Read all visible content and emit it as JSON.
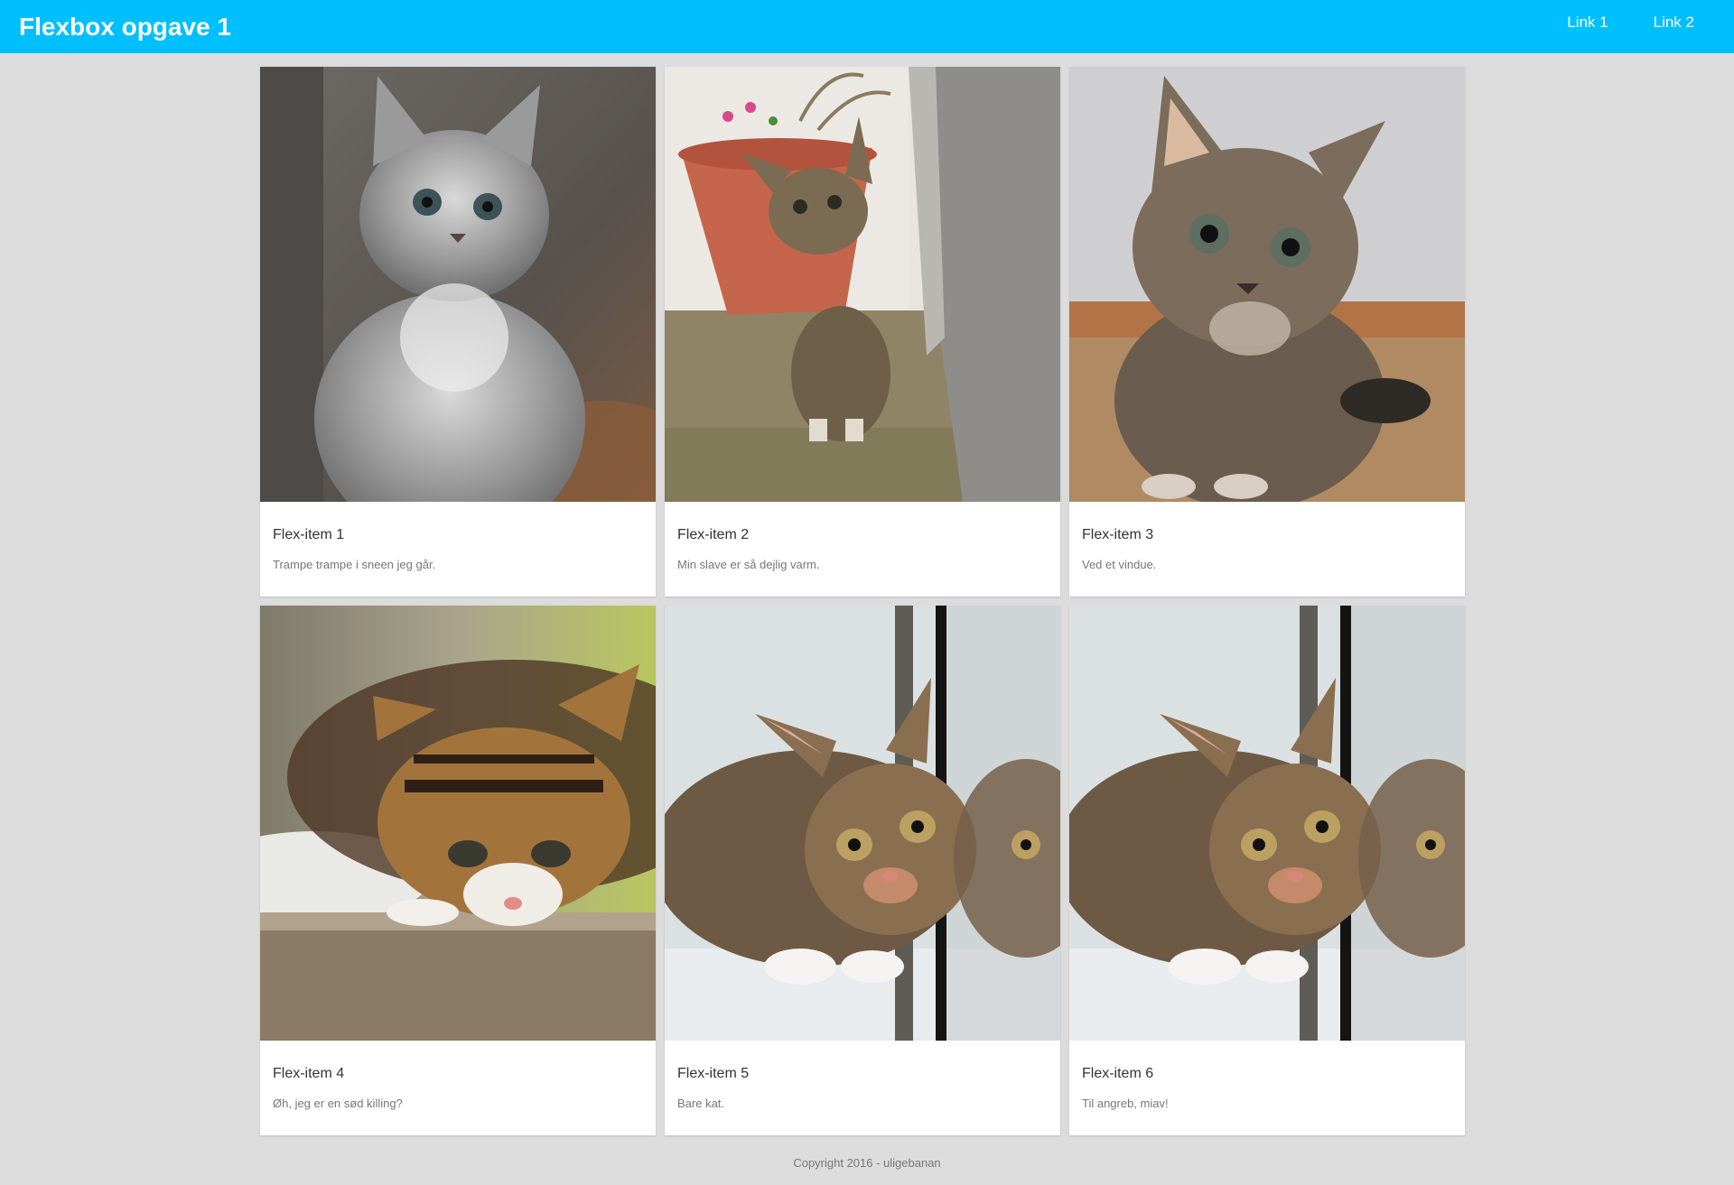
{
  "header": {
    "brand": "Flexbox opgave 1",
    "links": [
      "Link 1",
      "Link 2"
    ]
  },
  "colors": {
    "header_bg": "#00bfff",
    "page_bg": "#dcdcdc",
    "card_bg": "#ffffff"
  },
  "cards": [
    {
      "title": "Flex-item 1",
      "text": "Trampe trampe i sneen jeg går.",
      "image": "grey-kitten-photo"
    },
    {
      "title": "Flex-item 2",
      "text": "Min slave er så dejlig varm.",
      "image": "tabby-kitten-flowerpot-photo"
    },
    {
      "title": "Flex-item 3",
      "text": "Ved et vindue.",
      "image": "fluffy-tabby-kitten-photo"
    },
    {
      "title": "Flex-item 4",
      "text": "Øh, jeg er en sød killing?",
      "image": "calico-kitten-photo"
    },
    {
      "title": "Flex-item 5",
      "text": "Bare kat.",
      "image": "kitten-mirror-photo"
    },
    {
      "title": "Flex-item 6",
      "text": "Til angreb, miav!",
      "image": "kitten-mirror-photo"
    }
  ],
  "footer": {
    "text": "Copyright 2016 - uligebanan"
  }
}
